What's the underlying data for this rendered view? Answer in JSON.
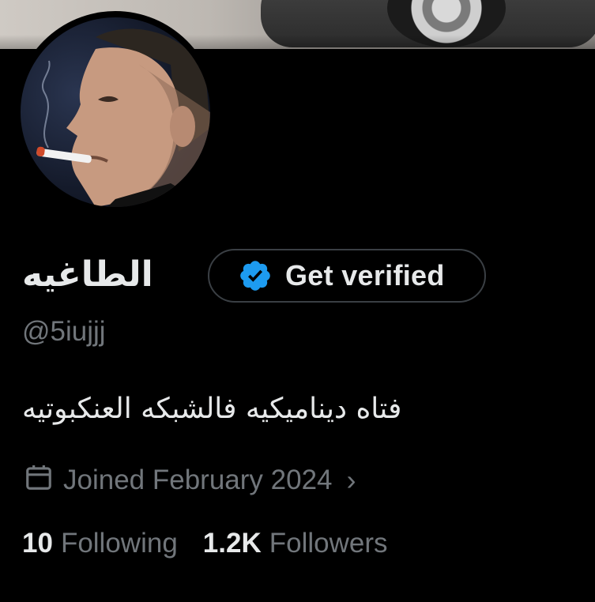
{
  "profile": {
    "display_name": "الطاغيه",
    "handle": "@5iujjj",
    "bio": "فتاه ديناميكيه فالشبكه العنكبوتيه",
    "joined": "Joined February 2024",
    "verify_button": "Get verified"
  },
  "stats": {
    "following_count": "10",
    "following_label": "Following",
    "followers_count": "1.2K",
    "followers_label": "Followers"
  },
  "icons": {
    "calendar": "calendar-icon",
    "verified": "verified-badge-icon",
    "chevron": "chevron-right-icon"
  },
  "colors": {
    "background": "#000000",
    "text_primary": "#e7e9ea",
    "text_secondary": "#71767b",
    "verified_blue": "#1d9bf0"
  }
}
